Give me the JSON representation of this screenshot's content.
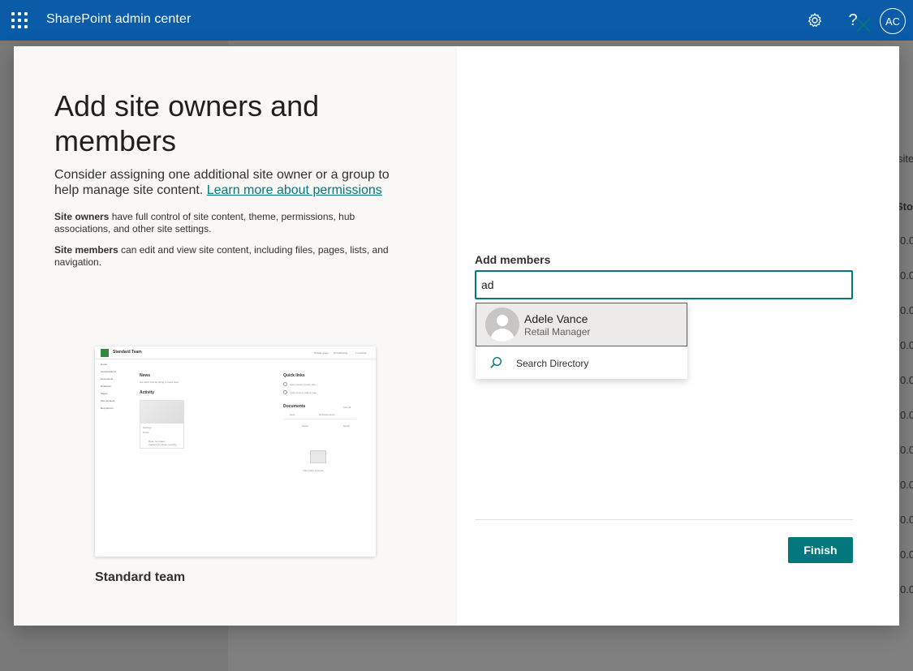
{
  "suite_bar": {
    "app_title": "SharePoint admin center",
    "user_initials": "AC",
    "help_glyph": "?",
    "icons": [
      "waffle-icon",
      "gear-icon",
      "help-icon"
    ],
    "color": "#0a5ba8"
  },
  "background": {
    "fragments": [
      "site",
      "Sto",
      "0.0",
      "0.0",
      "0.0",
      "0.0",
      "0.0",
      "0.0",
      "0.0",
      "0.0",
      "0.0",
      "0.0",
      "0.0",
      "0.0"
    ]
  },
  "dialog": {
    "heading": "Add site owners and members",
    "intro_text": "Consider assigning one additional site owner or a group to help manage site content.",
    "intro_link": "Learn more about permissions",
    "owners_term": "Site owners",
    "owners_desc": "have full control of site content, theme, permissions, hub associations, and other site settings.",
    "members_term": "Site members",
    "members_desc": "can edit and view site content, including files, pages, lists, and navigation.",
    "template_name": "Standard team",
    "preview": {
      "title": "Standard Team",
      "top_right": [
        "Private group",
        "Not following",
        "1 member"
      ],
      "nav": [
        "Home",
        "Conversations",
        "Documents",
        "Notebook",
        "Pages",
        "Site contents",
        "Recycle bin"
      ],
      "news_heading": "News",
      "news_text": "We didn't find anything in news feed.",
      "activity_heading": "Activity",
      "quick_links_heading": "Quick links",
      "quick_links": [
        "Learn about a team site",
        "Learn how to add a page"
      ],
      "documents_heading": "Documents",
      "documents_see_all": "See all",
      "documents_new": "New",
      "documents_all": "All Documents",
      "documents_col_name": "Name",
      "documents_col_modified": "Modif",
      "card_text_1": "Settings",
      "card_text_2": "Notes",
      "card_person": "Ryan Gonzalez",
      "card_person_sub": "Viewed the folder recently",
      "empty_folder": "This folder is empty"
    },
    "add_members_label": "Add members",
    "add_members_value": "ad",
    "suggestions": [
      {
        "name": "Adele Vance",
        "role": "Retail Manager"
      }
    ],
    "search_directory": "Search Directory",
    "finish_label": "Finish",
    "accent": "#03787c"
  }
}
